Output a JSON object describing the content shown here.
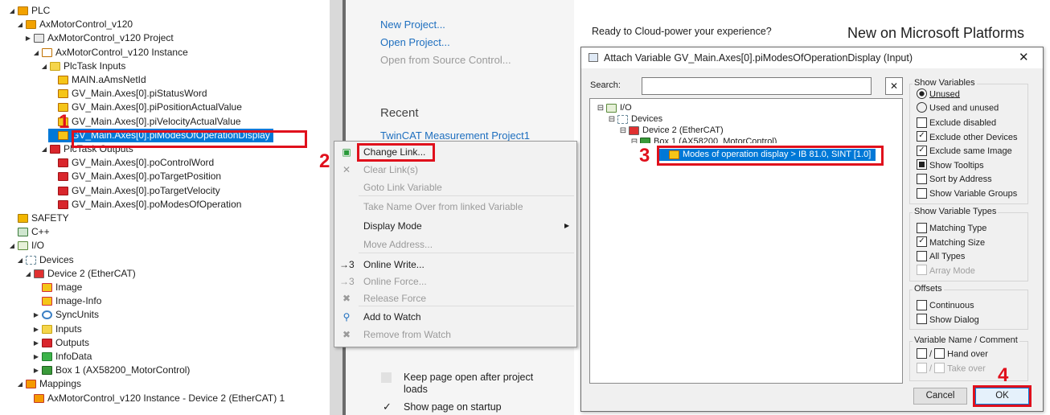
{
  "solution_tree": {
    "nodes": [
      {
        "label": "PLC",
        "icon": "plc-icon",
        "toggle": "◢"
      },
      {
        "label": "AxMotorControl_v120",
        "icon": "plc-project-icon",
        "toggle": "◢"
      },
      {
        "label": "AxMotorControl_v120 Project",
        "icon": "project-icon",
        "toggle": "▶"
      },
      {
        "label": "AxMotorControl_v120 Instance",
        "icon": "instance-icon",
        "toggle": "◢"
      },
      {
        "label": "PlcTask Inputs",
        "icon": "folder-icon",
        "toggle": "◢"
      },
      {
        "label": "MAIN.aAmsNetId",
        "icon": "input-variable-icon",
        "toggle": ""
      },
      {
        "label": "GV_Main.Axes[0].piStatusWord",
        "icon": "input-variable-icon",
        "toggle": ""
      },
      {
        "label": "GV_Main.Axes[0].piPositionActualValue",
        "icon": "input-variable-icon",
        "toggle": ""
      },
      {
        "label": "GV_Main.Axes[0].piVelocityActualValue",
        "icon": "input-variable-icon",
        "toggle": ""
      },
      {
        "label": "GV_Main.Axes[0].piModesOfOperationDisplay",
        "icon": "input-variable-icon",
        "toggle": ""
      },
      {
        "label": "PlcTask Outputs",
        "icon": "outputs-folder-icon",
        "toggle": "◢"
      },
      {
        "label": "GV_Main.Axes[0].poControlWord",
        "icon": "output-variable-icon",
        "toggle": ""
      },
      {
        "label": "GV_Main.Axes[0].poTargetPosition",
        "icon": "output-variable-icon",
        "toggle": ""
      },
      {
        "label": "GV_Main.Axes[0].poTargetVelocity",
        "icon": "output-variable-icon",
        "toggle": ""
      },
      {
        "label": "GV_Main.Axes[0].poModesOfOperation",
        "icon": "output-variable-icon",
        "toggle": ""
      },
      {
        "label": "SAFETY",
        "icon": "safety-icon",
        "toggle": ""
      },
      {
        "label": "C++",
        "icon": "cpp-icon",
        "toggle": ""
      },
      {
        "label": "I/O",
        "icon": "io-icon",
        "toggle": "◢"
      },
      {
        "label": "Devices",
        "icon": "devices-icon",
        "toggle": "◢"
      },
      {
        "label": "Device 2 (EtherCAT)",
        "icon": "ethercat-device-icon",
        "toggle": "◢"
      },
      {
        "label": "Image",
        "icon": "image-icon",
        "toggle": ""
      },
      {
        "label": "Image-Info",
        "icon": "image-info-icon",
        "toggle": ""
      },
      {
        "label": "SyncUnits",
        "icon": "syncunits-icon",
        "toggle": "▶"
      },
      {
        "label": "Inputs",
        "icon": "folder-icon",
        "toggle": "▶"
      },
      {
        "label": "Outputs",
        "icon": "outputs-folder-icon",
        "toggle": "▶"
      },
      {
        "label": "InfoData",
        "icon": "infodata-icon",
        "toggle": "▶"
      },
      {
        "label": "Box 1 (AX58200_MotorControl)",
        "icon": "box-icon",
        "toggle": "▶"
      },
      {
        "label": "Mappings",
        "icon": "mappings-icon",
        "toggle": "◢"
      },
      {
        "label": "AxMotorControl_v120 Instance - Device 2 (EtherCAT) 1",
        "icon": "mapping-item-icon",
        "toggle": ""
      }
    ]
  },
  "steps": {
    "s1": "1",
    "s2": "2",
    "s3": "3",
    "s4": "4"
  },
  "start_page": {
    "new_project": "New Project...",
    "open_project": "Open Project...",
    "open_source_control": "Open from Source Control...",
    "recent_heading": "Recent",
    "recent_item": "TwinCAT Measurement Project1",
    "keep_open": "Keep page open after project loads",
    "show_on_startup": "Show page on startup",
    "cloud_text": "Ready to Cloud-power your experience?",
    "news_heading": "New on Microsoft Platforms"
  },
  "context_menu": {
    "items": [
      {
        "label": "Change Link...",
        "icon": "change-link-icon",
        "glyph": "▣",
        "enabled": true
      },
      {
        "label": "Clear Link(s)",
        "icon": "clear-link-icon",
        "glyph": "✕",
        "enabled": false
      },
      {
        "label": "Goto Link Variable",
        "icon": "",
        "glyph": "",
        "enabled": false
      },
      {
        "label": "Take Name Over from linked Variable",
        "icon": "",
        "glyph": "",
        "enabled": false
      },
      {
        "label": "Display Mode",
        "icon": "",
        "glyph": "",
        "enabled": true,
        "submenu": true
      },
      {
        "label": "Move Address...",
        "icon": "",
        "glyph": "",
        "enabled": false
      },
      {
        "label": "Online Write...",
        "icon": "online-write-icon",
        "glyph": "→3",
        "enabled": true
      },
      {
        "label": "Online Force...",
        "icon": "online-force-icon",
        "glyph": "→3",
        "enabled": false
      },
      {
        "label": "Release Force",
        "icon": "release-force-icon",
        "glyph": "✖",
        "enabled": false
      },
      {
        "label": "Add to Watch",
        "icon": "add-watch-icon",
        "glyph": "⚲",
        "enabled": true
      },
      {
        "label": "Remove from Watch",
        "icon": "remove-watch-icon",
        "glyph": "✖",
        "enabled": false
      }
    ]
  },
  "dialog": {
    "title": "Attach Variable GV_Main.Axes[0].piModesOfOperationDisplay (Input)",
    "close_glyph": "✕",
    "search_label": "Search:",
    "search_value": "",
    "search_clear_glyph": "✕",
    "tree": [
      {
        "label": "I/O",
        "toggle": "⊟",
        "icon": "io-icon"
      },
      {
        "label": "Devices",
        "toggle": "⊟",
        "icon": "devices-icon"
      },
      {
        "label": "Device 2 (EtherCAT)",
        "toggle": "⊟",
        "icon": "ethercat-device-icon"
      },
      {
        "label": "Box 1 (AX58200_MotorControl)",
        "toggle": "⊟",
        "icon": "box-icon"
      },
      {
        "label": "Modes of operation display  >  IB 81.0, SINT [1.0]",
        "toggle": "",
        "icon": "input-variable-icon"
      }
    ],
    "show_variables": {
      "title": "Show Variables",
      "unused": "Unused",
      "used_and_unused": "Used and unused",
      "selected": "unused",
      "options": [
        {
          "label": "Exclude disabled",
          "checked": false,
          "style": "check"
        },
        {
          "label": "Exclude other Devices",
          "checked": true,
          "style": "check"
        },
        {
          "label": "Exclude same Image",
          "checked": true,
          "style": "check"
        },
        {
          "label": "Show Tooltips",
          "checked": true,
          "style": "filled"
        },
        {
          "label": "Sort by Address",
          "checked": false,
          "style": "check"
        },
        {
          "label": "Show Variable Groups",
          "checked": false,
          "style": "check"
        }
      ]
    },
    "show_types": {
      "title": "Show Variable Types",
      "options": [
        {
          "label": "Matching Type",
          "checked": false,
          "enabled": true
        },
        {
          "label": "Matching Size",
          "checked": true,
          "enabled": true
        },
        {
          "label": "All Types",
          "checked": false,
          "enabled": true
        },
        {
          "label": "Array Mode",
          "checked": false,
          "enabled": false
        }
      ]
    },
    "offsets": {
      "title": "Offsets",
      "options": [
        {
          "label": "Continuous",
          "checked": false
        },
        {
          "label": "Show Dialog",
          "checked": false
        }
      ]
    },
    "name_comment": {
      "title": "Variable Name / Comment",
      "hand_over": "Hand over",
      "take_over": "Take over",
      "sep": "/"
    },
    "cancel_label": "Cancel",
    "ok_label": "OK"
  },
  "colors": {
    "step_red": "#e0101c",
    "selection_blue": "#0078d7",
    "link_blue": "#1e6fbf",
    "dialog_bg": "#f0f0f0"
  }
}
